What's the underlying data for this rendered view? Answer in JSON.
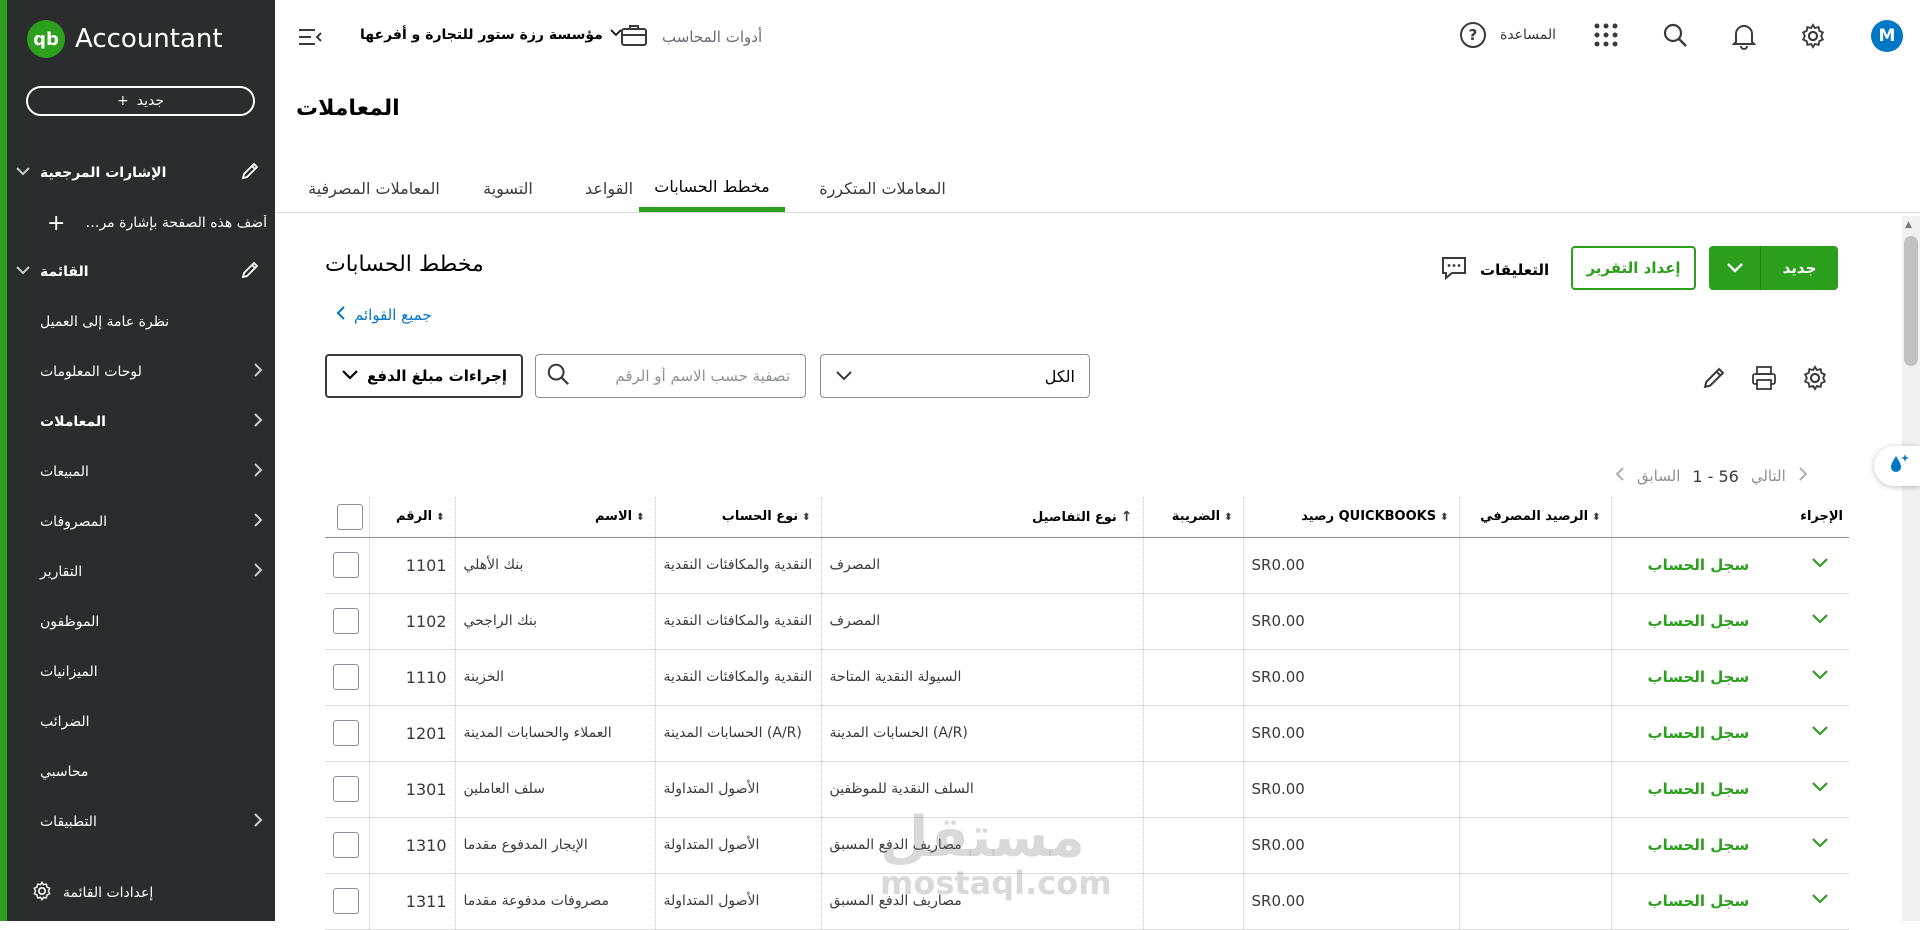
{
  "sidebar": {
    "brand": "Accountant",
    "brand_mark": "qb",
    "new_label": "جديد",
    "bookmarks_header": "الإشارات المرجعية",
    "bookmark_add_label": "أضف هذه الصفحة بإشارة مرجعية",
    "menu_header": "القائمة",
    "items": [
      {
        "label": "نظرة عامة إلى العميل",
        "chevron": false,
        "active": false
      },
      {
        "label": "لوحات المعلومات",
        "chevron": true,
        "active": false
      },
      {
        "label": "المعاملات",
        "chevron": true,
        "active": true
      },
      {
        "label": "المبيعات",
        "chevron": true,
        "active": false
      },
      {
        "label": "المصروفات",
        "chevron": true,
        "active": false
      },
      {
        "label": "التقارير",
        "chevron": true,
        "active": false
      },
      {
        "label": "الموظفون",
        "chevron": false,
        "active": false
      },
      {
        "label": "الميزانيات",
        "chevron": false,
        "active": false
      },
      {
        "label": "الضرائب",
        "chevron": false,
        "active": false
      },
      {
        "label": "محاسبي",
        "chevron": false,
        "active": false
      },
      {
        "label": "التطبيقات",
        "chevron": true,
        "active": false
      }
    ],
    "footer_label": "إعدادات القائمة"
  },
  "topbar": {
    "company": "مؤسسة رزة ستور للتجارة و أفرعها",
    "tools_label": "أدوات المحاسب",
    "help_label": "المساعدة",
    "help_symbol": "?",
    "avatar_letter": "M"
  },
  "page": {
    "title": "المعاملات",
    "tabs": [
      {
        "label": "المعاملات المصرفية",
        "active": false
      },
      {
        "label": "التسوية",
        "active": false
      },
      {
        "label": "القواعد",
        "active": false
      },
      {
        "label": "مخطط الحسابات",
        "active": true
      },
      {
        "label": "المعاملات المتكررة",
        "active": false
      }
    ]
  },
  "content": {
    "title": "مخطط الحسابات",
    "all_lists": "جميع القوائم",
    "new_button": "جديد",
    "report_button": "إعداد التقرير",
    "comments_label": "التعليقات",
    "batch_actions": "إجراءات مبلغ الدفع",
    "search_placeholder": "تصفية حسب الاسم أو الرقم",
    "filter_value": "الكل",
    "pager": {
      "prev": "السابق",
      "range": "1 - 56",
      "next": "التالي"
    }
  },
  "table": {
    "headers": {
      "number": "الرقم",
      "name": "الاسم",
      "account_type": "نوع الحساب",
      "detail_type": "نوع التفاصيل",
      "tax": "الضريبة",
      "qb_balance": "رصيد QUICKBOOKS",
      "bank_balance": "الرصيد المصرفي",
      "action": "الإجراء"
    },
    "rows": [
      {
        "number": "1101",
        "name": "بنك الأهلي",
        "account_type": "النقدية والمكافئات النقدية",
        "detail_type": "المصرف",
        "tax": "",
        "qb_balance": "SR0.00",
        "bank_balance": "",
        "action": "سجل الحساب"
      },
      {
        "number": "1102",
        "name": "بنك الراجحي",
        "account_type": "النقدية والمكافئات النقدية",
        "detail_type": "المصرف",
        "tax": "",
        "qb_balance": "SR0.00",
        "bank_balance": "",
        "action": "سجل الحساب"
      },
      {
        "number": "1110",
        "name": "الخزينة",
        "account_type": "النقدية والمكافئات النقدية",
        "detail_type": "السيولة النقدية المتاحة",
        "tax": "",
        "qb_balance": "SR0.00",
        "bank_balance": "",
        "action": "سجل الحساب"
      },
      {
        "number": "1201",
        "name": "العملاء والحسابات المدينة",
        "account_type": "الحسابات المدينة (A/R)",
        "detail_type": "الحسابات المدينة (A/R)",
        "tax": "",
        "qb_balance": "SR0.00",
        "bank_balance": "",
        "action": "سجل الحساب"
      },
      {
        "number": "1301",
        "name": "سلف العاملين",
        "account_type": "الأصول المتداولة",
        "detail_type": "السلف النقدية للموظفين",
        "tax": "",
        "qb_balance": "SR0.00",
        "bank_balance": "",
        "action": "سجل الحساب"
      },
      {
        "number": "1310",
        "name": "الإيجار المدفوع مقدما",
        "account_type": "الأصول المتداولة",
        "detail_type": "مصاريف الدفع المسبق",
        "tax": "",
        "qb_balance": "SR0.00",
        "bank_balance": "",
        "action": "سجل الحساب"
      },
      {
        "number": "1311",
        "name": "مصروفات مدفوعة مقدما",
        "account_type": "الأصول المتداولة",
        "detail_type": "مصاريف الدفع المسبق",
        "tax": "",
        "qb_balance": "SR0.00",
        "bank_balance": "",
        "action": "سجل الحساب"
      }
    ]
  },
  "watermark": {
    "arabic": "مستقل",
    "latin": "mostaql.com"
  },
  "colors": {
    "brand_green": "#2ca01c",
    "sidebar_bg": "#2b2c2e",
    "link_blue": "#0077c5"
  },
  "icons": [
    "hamburger-icon",
    "chevron-down-icon",
    "briefcase-icon",
    "help-icon",
    "apps-grid-icon",
    "search-icon",
    "bell-icon",
    "gear-icon",
    "pencil-icon",
    "printer-icon",
    "comment-icon",
    "plus-icon",
    "chevron-left-icon",
    "chevron-right-icon",
    "sort-icon",
    "arrow-up-icon",
    "sparkle-drop-icon"
  ]
}
